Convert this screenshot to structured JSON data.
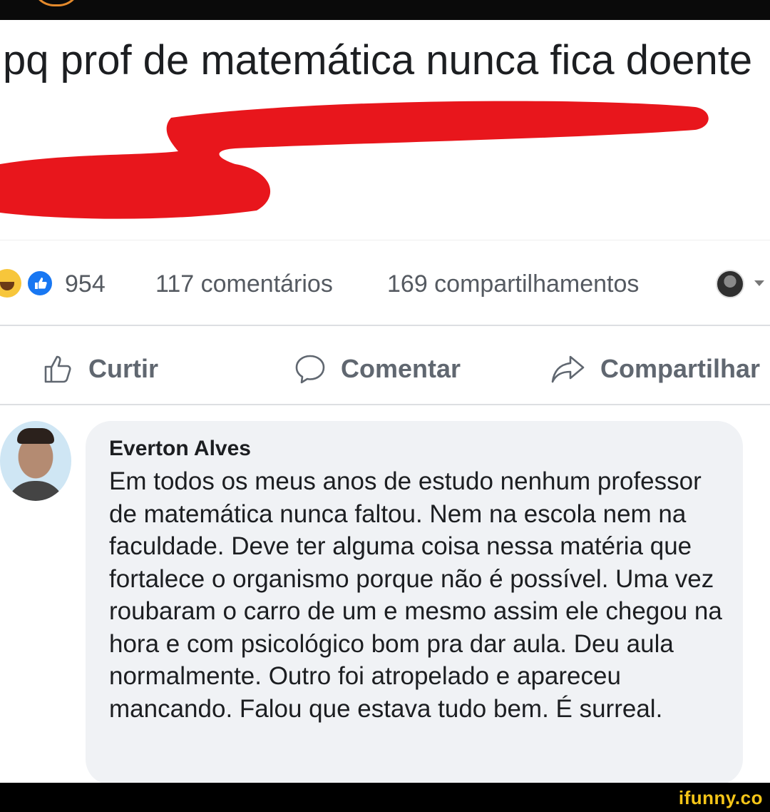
{
  "post": {
    "text": "pq prof de matemática nunca fica doente"
  },
  "stats": {
    "reactions": [
      "haha-icon",
      "like-icon"
    ],
    "reaction_count": "954",
    "comments": "117 comentários",
    "shares": "169 compartilhamentos"
  },
  "actions": {
    "like": "Curtir",
    "comment": "Comentar",
    "share": "Compartilhar"
  },
  "comment": {
    "author": "Everton Alves",
    "text": "Em todos os meus anos de estudo nenhum professor de matemática nunca faltou. Nem na escola nem na faculdade. Deve ter alguma coisa nessa matéria que fortalece o organismo porque não é possível. Uma vez roubaram o carro de um e mesmo assim ele chegou na hora e com psicológico bom pra dar aula. Deu aula normalmente. Outro foi atropelado e apareceu mancando. Falou que estava tudo bem. É surreal."
  },
  "watermark": "ifunny.co",
  "colors": {
    "scribble": "#e8161c",
    "like_blue": "#1877f2",
    "watermark": "#f5c518",
    "bubble": "#f0f2f5"
  }
}
